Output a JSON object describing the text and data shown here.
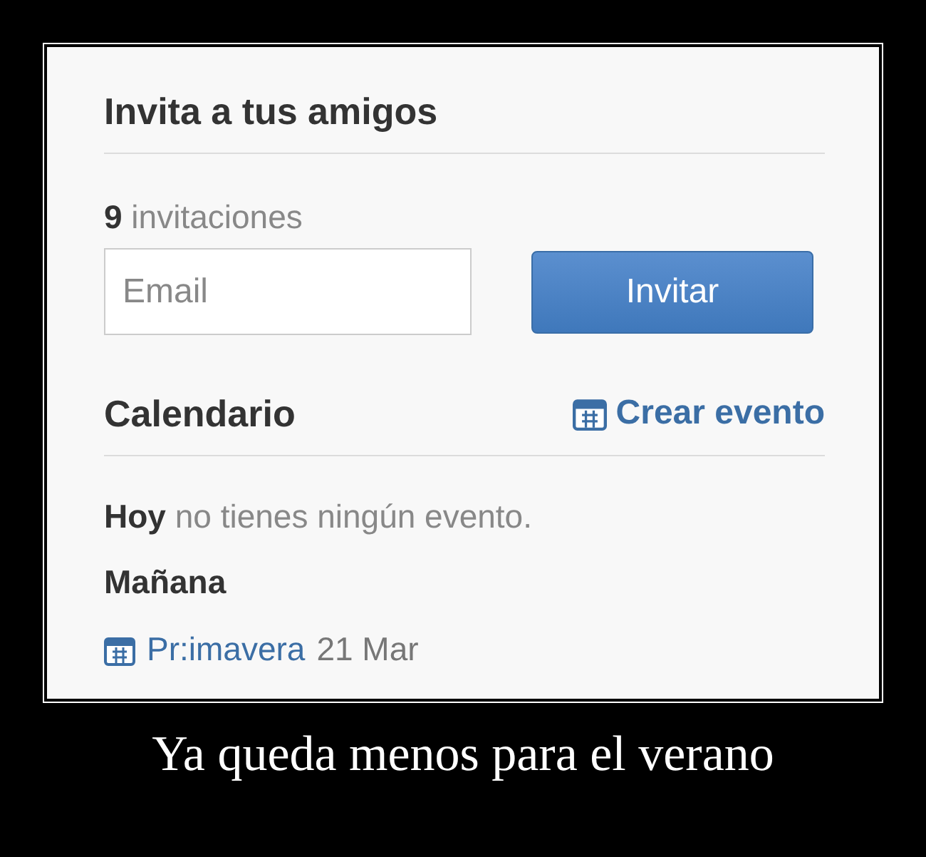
{
  "invite": {
    "title": "Invita a tus amigos",
    "count_text": "**9** invitaciones",
    "email": {
      "placeholder": "Email"
    },
    "button": "Invitar"
  },
  "calendar": {
    "title": "Calendario",
    "create_link": "Crear evento",
    "today_text": "**Hoy** no tienes ningún evento.",
    "tomorrow_label": "Mañana",
    "events": [
      {
        "name": "Pr:imavera",
        "date": "21 Mar"
      }
    ]
  },
  "caption": "Ya queda menos para el verano"
}
